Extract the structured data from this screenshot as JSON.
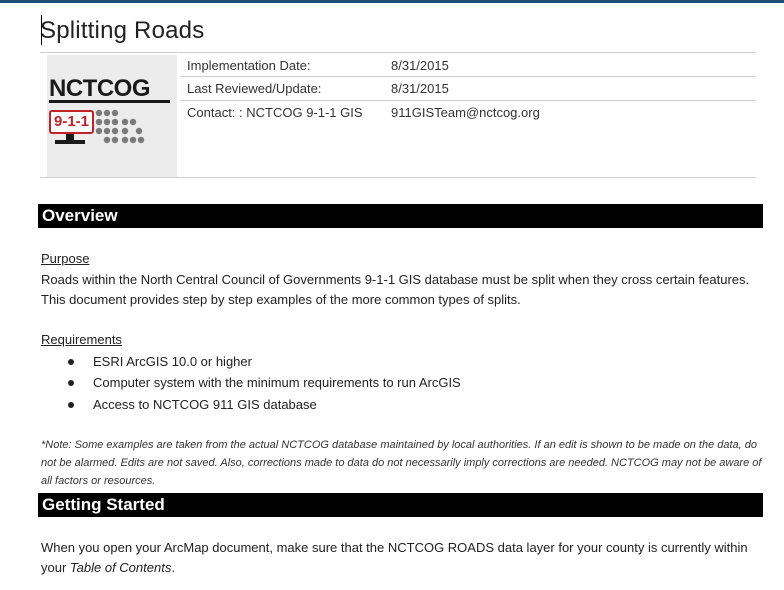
{
  "document": {
    "title": "Splitting Roads"
  },
  "header_table": {
    "rows": [
      {
        "label": "Implementation Date:",
        "value": "8/31/2015"
      },
      {
        "label": "Last Reviewed/Update:",
        "value": "8/31/2015"
      },
      {
        "label": "Contact: :  NCTCOG 9-1-1 GIS",
        "value": "911GISTeam@nctcog.org"
      }
    ]
  },
  "logo": {
    "org": "NCTCOG",
    "badge": "9-1-1"
  },
  "overview": {
    "heading": "Overview",
    "purpose_label": "Purpose",
    "purpose_text": "Roads within the North Central Council of Governments 9-1-1 GIS database must be split when they cross certain features.  This document provides step by step examples of the more common types of splits.",
    "requirements_label": "Requirements",
    "requirements": [
      "ESRI ArcGIS 10.0 or higher",
      "Computer system with the minimum requirements to run ArcGIS",
      "Access to NCTCOG 911 GIS database"
    ],
    "note": "*Note:  Some examples are taken from the actual NCTCOG database maintained by local authorities.  If an edit is shown to be made on the data, do not be alarmed.  Edits are not saved.  Also, corrections made to data do not necessarily imply corrections are needed.  NCTCOG may not be aware of all factors or resources."
  },
  "getting_started": {
    "heading": "Getting Started",
    "text_before": "When you open your ArcMap document, make sure that the NCTCOG ROADS data layer for your county is currently within your ",
    "text_italic": "Table of Contents",
    "text_after": "."
  }
}
